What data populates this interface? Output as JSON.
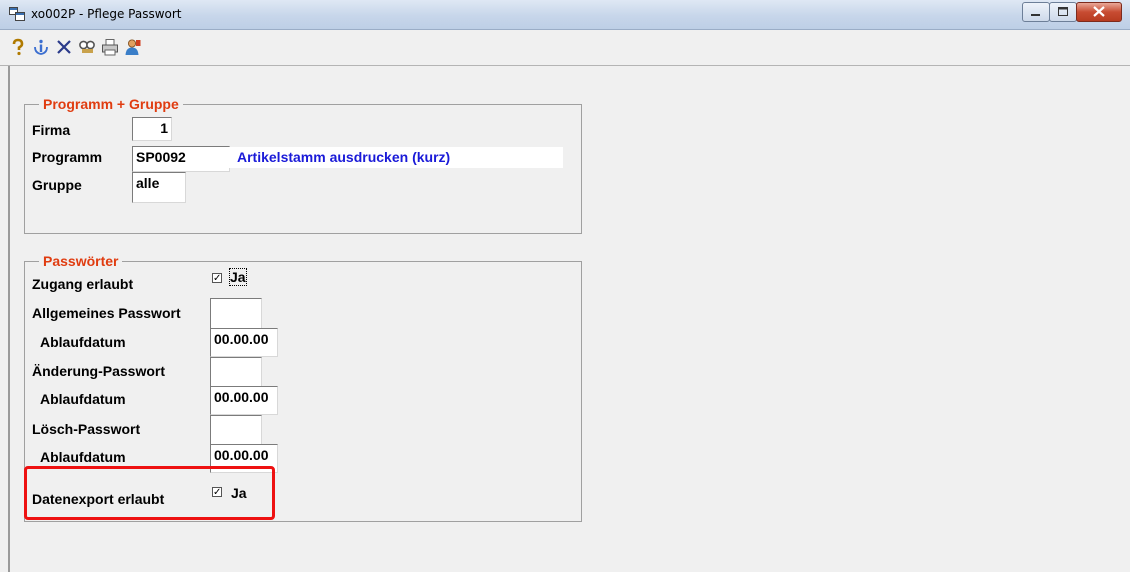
{
  "window": {
    "title": "xo002P - Pflege Passwort"
  },
  "toolbar": {
    "icons": [
      "help-icon",
      "info-icon",
      "delete-icon",
      "search-icon",
      "print-icon",
      "user-icon"
    ]
  },
  "group_programm": {
    "legend": "Programm + Gruppe",
    "firma_label": "Firma",
    "firma_value": "1",
    "programm_label": "Programm",
    "programm_value": "SP0092",
    "programm_desc": "Artikelstamm ausdrucken (kurz)",
    "gruppe_label": "Gruppe",
    "gruppe_value": "alle"
  },
  "group_passwoerter": {
    "legend": "Passwörter",
    "zugang_label": "Zugang erlaubt",
    "zugang_checked": true,
    "zugang_check_label": "Ja",
    "allgemein_label": "Allgemeines Passwort",
    "allgemein_value": "",
    "allgemein_ablauf_label": "Ablaufdatum",
    "allgemein_ablauf_value": "00.00.00",
    "aenderung_label": "Änderung-Passwort",
    "aenderung_value": "",
    "aenderung_ablauf_label": "Ablaufdatum",
    "aenderung_ablauf_value": "00.00.00",
    "loesch_label": "Lösch-Passwort",
    "loesch_value": "",
    "loesch_ablauf_label": "Ablaufdatum",
    "loesch_ablauf_value": "00.00.00",
    "export_label": "Datenexport erlaubt",
    "export_checked": true,
    "export_check_label": "Ja"
  },
  "colors": {
    "legend": "#e03c10",
    "description": "#1a1ad8",
    "highlight": "#ee1111"
  },
  "checkmark_glyph": "✓"
}
